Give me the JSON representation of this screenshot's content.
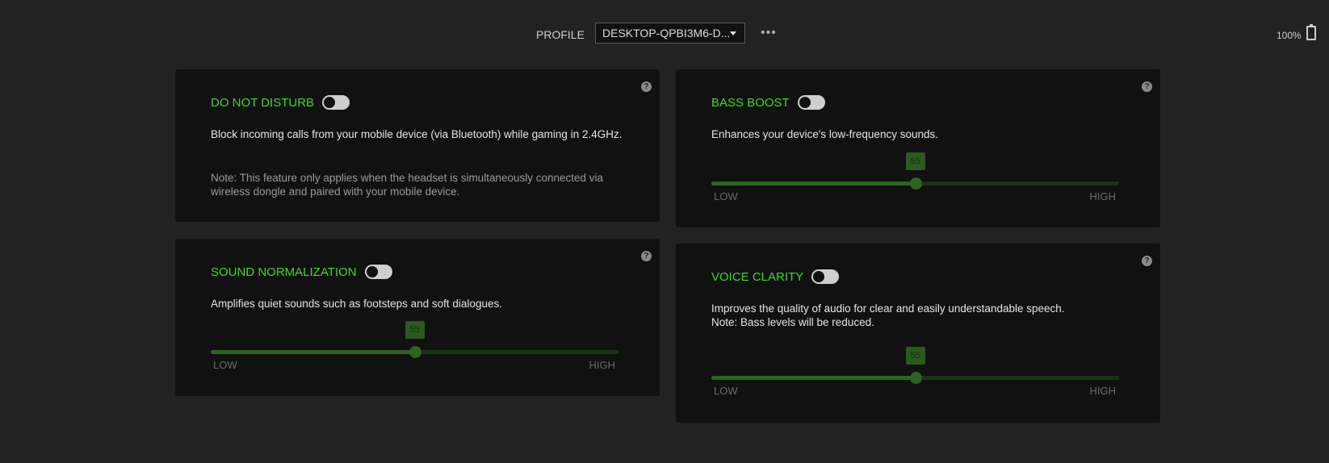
{
  "header": {
    "profile_label": "PROFILE",
    "profile_value": "DESKTOP-QPBI3M6-D...",
    "more_label": "•••",
    "battery": "100%"
  },
  "cards": {
    "dnd": {
      "title": "DO NOT DISTURB",
      "toggle_on": false,
      "desc": "Block incoming calls from your mobile device (via Bluetooth) while gaming in 2.4GHz.",
      "note": "Note: This feature only applies when the headset is simultaneously connected via wireless dongle and paired with your mobile device.",
      "help": "?"
    },
    "sn": {
      "title": "SOUND NORMALIZATION",
      "toggle_on": false,
      "desc": "Amplifies quiet sounds such as footsteps and soft dialogues.",
      "value": "55",
      "low": "LOW",
      "high": "HIGH",
      "help": "?"
    },
    "bb": {
      "title": "BASS BOOST",
      "toggle_on": false,
      "desc": "Enhances your device's low-frequency sounds.",
      "value": "55",
      "low": "LOW",
      "high": "HIGH",
      "help": "?"
    },
    "vc": {
      "title": "VOICE CLARITY",
      "toggle_on": false,
      "desc": "Improves the quality of audio for clear and easily understandable speech.",
      "note": "Note: Bass levels will be reduced.",
      "value": "55",
      "low": "LOW",
      "high": "HIGH",
      "help": "?"
    }
  },
  "colors": {
    "accent": "#44d62c",
    "slider_fill": "#2c6422",
    "card_bg": "#111111",
    "page_bg": "#222222"
  }
}
